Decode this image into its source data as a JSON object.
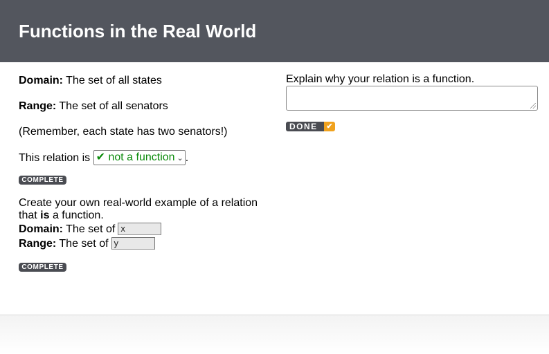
{
  "header": {
    "title": "Functions in the Real World"
  },
  "left": {
    "domain_label": "Domain:",
    "domain_text": "The set of all states",
    "range_label": "Range:",
    "range_text": "The set of all senators",
    "remember_text": "(Remember, each state has two senators!)",
    "relation_prefix": "This relation is",
    "relation_select": {
      "check": "✔",
      "value": "not a function"
    },
    "relation_suffix": ".",
    "complete_label_1": "COMPLETE",
    "create_text_1": "Create your own real-world example of a relation",
    "create_text_2a": "that",
    "create_text_2b": "is",
    "create_text_2c": "a function.",
    "own_domain_label": "Domain:",
    "own_domain_text": "The set of",
    "own_domain_value": "x",
    "own_range_label": "Range:",
    "own_range_text": "The set of",
    "own_range_value": "y",
    "complete_label_2": "COMPLETE"
  },
  "right": {
    "prompt": "Explain why your relation is a function.",
    "textarea_value": "",
    "done_label": "DONE",
    "done_check": "✔"
  },
  "colors": {
    "header_bg": "#53565e",
    "select_text": "#0a8a0a",
    "done_accent": "#f0a21e",
    "button_bg": "#4a4c52"
  }
}
